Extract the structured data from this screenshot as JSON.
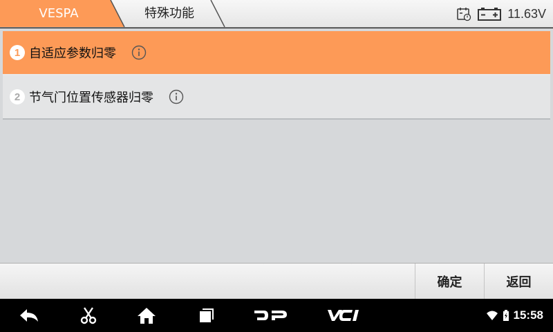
{
  "breadcrumb": {
    "items": [
      {
        "label": "VESPA"
      },
      {
        "label": "特殊功能"
      }
    ]
  },
  "status": {
    "voltage": "11.63V",
    "icons": [
      "calendar-clock-icon",
      "battery-icon"
    ]
  },
  "list": {
    "items": [
      {
        "number": "1",
        "label": "自适应参数归零",
        "selected": true
      },
      {
        "number": "2",
        "label": "节气门位置传感器归零",
        "selected": false
      }
    ]
  },
  "actions": {
    "ok_label": "确定",
    "back_label": "返回"
  },
  "navbar": {
    "time": "15:58",
    "icons": [
      "back-icon",
      "screenshot-icon",
      "home-icon",
      "recents-icon",
      "dp-icon",
      "vci-icon",
      "wifi-icon",
      "battery-icon"
    ]
  },
  "colors": {
    "accent": "#fd9a57",
    "selected_row": "#fd9a57",
    "content_bg": "#d6d8da",
    "navbar_bg": "#000000"
  }
}
